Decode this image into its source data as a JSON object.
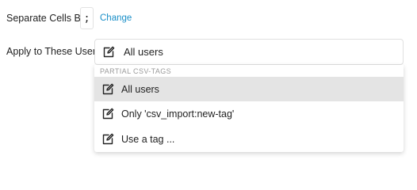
{
  "separator": {
    "label": "Separate Cells By:",
    "value": ";",
    "change_link": "Change"
  },
  "apply": {
    "label": "Apply to These Users:",
    "selected": "All users",
    "selected_icon": "edit-icon"
  },
  "dropdown": {
    "group_header": "PARTIAL CSV-TAGS",
    "options": [
      {
        "label": "All users",
        "icon": "edit-icon",
        "selected": true
      },
      {
        "label": "Only 'csv_import:new-tag'",
        "icon": "edit-icon",
        "selected": false
      },
      {
        "label": "Use a tag ...",
        "icon": "edit-icon",
        "selected": false
      }
    ]
  },
  "colors": {
    "link": "#1a8fc8",
    "selected_bg": "#e4e4e4"
  }
}
